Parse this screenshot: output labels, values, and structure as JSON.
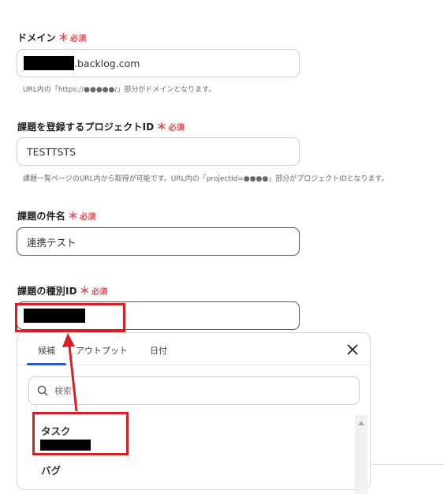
{
  "fields": {
    "domain": {
      "label": "ドメイン",
      "required_star": "＊",
      "required_text": "必須",
      "value_suffix": ".backlog.com",
      "help": "URL内の「https://●●●●●/」部分がドメインとなります。"
    },
    "project_id": {
      "label": "課題を登録するプロジェクトID",
      "required_star": "＊",
      "required_text": "必須",
      "value": "TESTTSTS",
      "help": "課題一覧ページのURL内から取得が可能です。URL内の「projectId=●●●●」部分がプロジェクトIDとなります。"
    },
    "subject": {
      "label": "課題の件名",
      "required_star": "＊",
      "required_text": "必須",
      "value": "連携テスト"
    },
    "issue_type": {
      "label": "課題の種別ID",
      "required_star": "＊",
      "required_text": "必須"
    }
  },
  "dropdown": {
    "tabs": [
      {
        "label": "候補"
      },
      {
        "label": "アウトプット"
      },
      {
        "label": "日付"
      }
    ],
    "active_tab": 0,
    "search_placeholder": "検索",
    "options": [
      {
        "label": "タスク"
      },
      {
        "label": "バグ"
      }
    ]
  },
  "colors": {
    "required": "#e5484d",
    "annotation": "#d61f26",
    "tab_active": "#2b5dc8"
  },
  "icons": {
    "close": "close-icon",
    "search": "search-icon"
  }
}
